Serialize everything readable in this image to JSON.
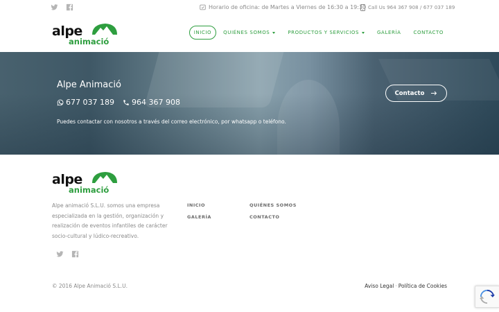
{
  "topbar": {
    "social": [
      "twitter-icon",
      "facebook-icon"
    ],
    "hours_text": "Horario de oficina: de Martes a Viernes de 16:30 a 19:30",
    "call_text": "Call Us 964 367 908 / 677 037 189"
  },
  "logo": {
    "word_top": "alpe",
    "word_bottom": "animació",
    "colors": {
      "text": "#111111",
      "green": "#2e9e3f"
    }
  },
  "nav": {
    "items": [
      {
        "label": "Inicio",
        "active": true,
        "dropdown": false
      },
      {
        "label": "Quiénes somos",
        "active": false,
        "dropdown": true
      },
      {
        "label": "Productos y servicios",
        "active": false,
        "dropdown": true
      },
      {
        "label": "Galería",
        "active": false,
        "dropdown": false
      },
      {
        "label": "Contacto",
        "active": false,
        "dropdown": false
      }
    ],
    "accent": "#2e9e3f"
  },
  "hero": {
    "title": "Alpe Animació",
    "phone_whatsapp": "677 037 189",
    "phone_tel": "964 367 908",
    "text": "Puedes contactar con nosotros a través del correo electrónico, por whatsapp o teléfono.",
    "button_label": "Contacto",
    "button_icon": "arrow-right-icon"
  },
  "footer": {
    "about": "Alpe animació S.L.U. somos una empresa especializada en la gestión, organización y realización de eventos infantiles de carácter socio-cultural y lúdico-recreativo.",
    "links": {
      "inicio": "Inicio",
      "galeria": "Galería",
      "quienes": "Quiénes somos",
      "contacto": "Contacto"
    },
    "social": [
      "twitter-icon",
      "facebook-icon"
    ],
    "copyright": "© 2016 Alpe Animació S.L.U.",
    "legal_1": "Aviso Legal",
    "legal_sep": "·",
    "legal_2": "Política de Cookies"
  }
}
